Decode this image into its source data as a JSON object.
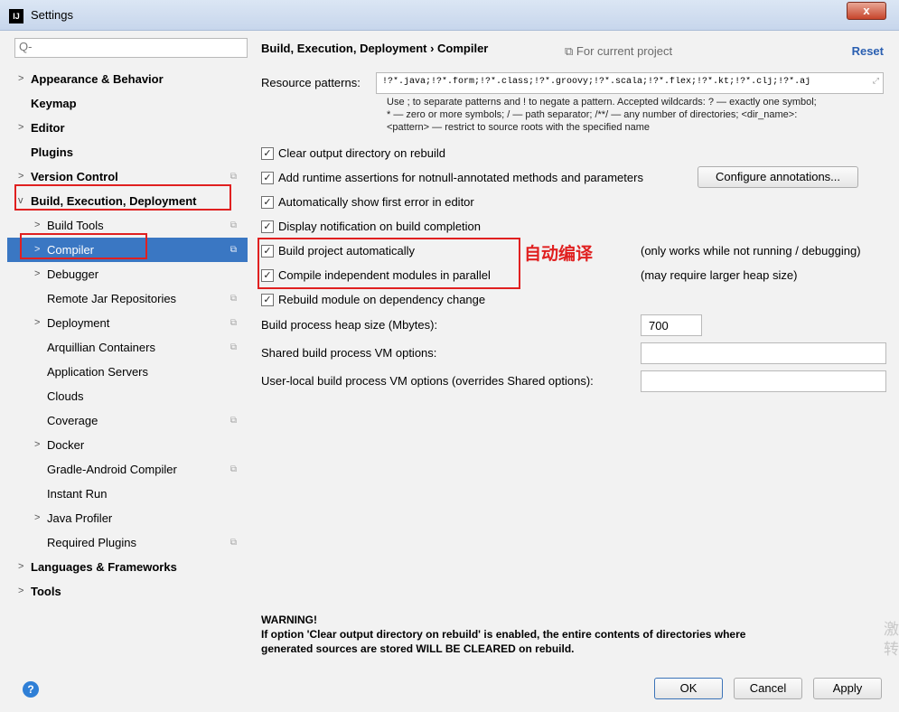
{
  "window": {
    "title": "Settings",
    "app_icon": "IJ",
    "close_label": "x"
  },
  "search": {
    "placeholder": "Q-"
  },
  "sidebar": {
    "items": [
      {
        "label": "Appearance & Behavior",
        "arrow": ">"
      },
      {
        "label": "Keymap"
      },
      {
        "label": "Editor",
        "arrow": ">"
      },
      {
        "label": "Plugins"
      },
      {
        "label": "Version Control",
        "arrow": ">"
      },
      {
        "label": "Build, Execution, Deployment",
        "arrow": "v"
      },
      {
        "label": "Build Tools",
        "arrow": ">"
      },
      {
        "label": "Compiler",
        "arrow": ">"
      },
      {
        "label": "Debugger",
        "arrow": ">"
      },
      {
        "label": "Remote Jar Repositories"
      },
      {
        "label": "Deployment",
        "arrow": ">"
      },
      {
        "label": "Arquillian Containers"
      },
      {
        "label": "Application Servers"
      },
      {
        "label": "Clouds"
      },
      {
        "label": "Coverage"
      },
      {
        "label": "Docker",
        "arrow": ">"
      },
      {
        "label": "Gradle-Android Compiler"
      },
      {
        "label": "Instant Run"
      },
      {
        "label": "Java Profiler",
        "arrow": ">"
      },
      {
        "label": "Required Plugins"
      },
      {
        "label": "Languages & Frameworks",
        "arrow": ">"
      },
      {
        "label": "Tools",
        "arrow": ">"
      }
    ]
  },
  "header": {
    "breadcrumb": "Build, Execution, Deployment  ›  Compiler",
    "scope": "⧉ For current project",
    "reset": "Reset"
  },
  "resource": {
    "label": "Resource patterns:",
    "value": "!?*.java;!?*.form;!?*.class;!?*.groovy;!?*.scala;!?*.flex;!?*.kt;!?*.clj;!?*.aj",
    "help_line1": "Use ; to separate patterns and ! to negate a pattern. Accepted wildcards: ? — exactly one symbol;",
    "help_line2": "* — zero or more symbols; / — path separator; /**/ — any number of directories; <dir_name>:",
    "help_line3": "<pattern> — restrict to source roots with the specified name"
  },
  "options": {
    "clear_output": "Clear output directory on rebuild",
    "add_assertions": "Add runtime assertions for notnull-annotated methods and parameters",
    "configure_annotations": "Configure annotations...",
    "show_first_error": "Automatically show first error in editor",
    "display_notification": "Display notification on build completion",
    "build_auto": "Build project automatically",
    "build_auto_note": "(only works while not running / debugging)",
    "compile_parallel": "Compile independent modules in parallel",
    "compile_parallel_note": "(may require larger heap size)",
    "rebuild_module": "Rebuild module on dependency change",
    "annotation": "自动编译"
  },
  "vm": {
    "heap_label": "Build process heap size (Mbytes):",
    "heap_value": "700",
    "shared_label": "Shared build process VM options:",
    "shared_value": "",
    "user_local_label": "User-local build process VM options (overrides Shared options):",
    "user_local_value": ""
  },
  "warning": {
    "title": "WARNING!",
    "line1": "If option 'Clear output directory on rebuild' is enabled, the entire contents of directories where",
    "line2": "generated sources are stored WILL BE CLEARED on rebuild."
  },
  "footer": {
    "ok": "OK",
    "cancel": "Cancel",
    "apply": "Apply",
    "help": "?"
  },
  "watermark": {
    "line1": "激",
    "line2": "转"
  }
}
